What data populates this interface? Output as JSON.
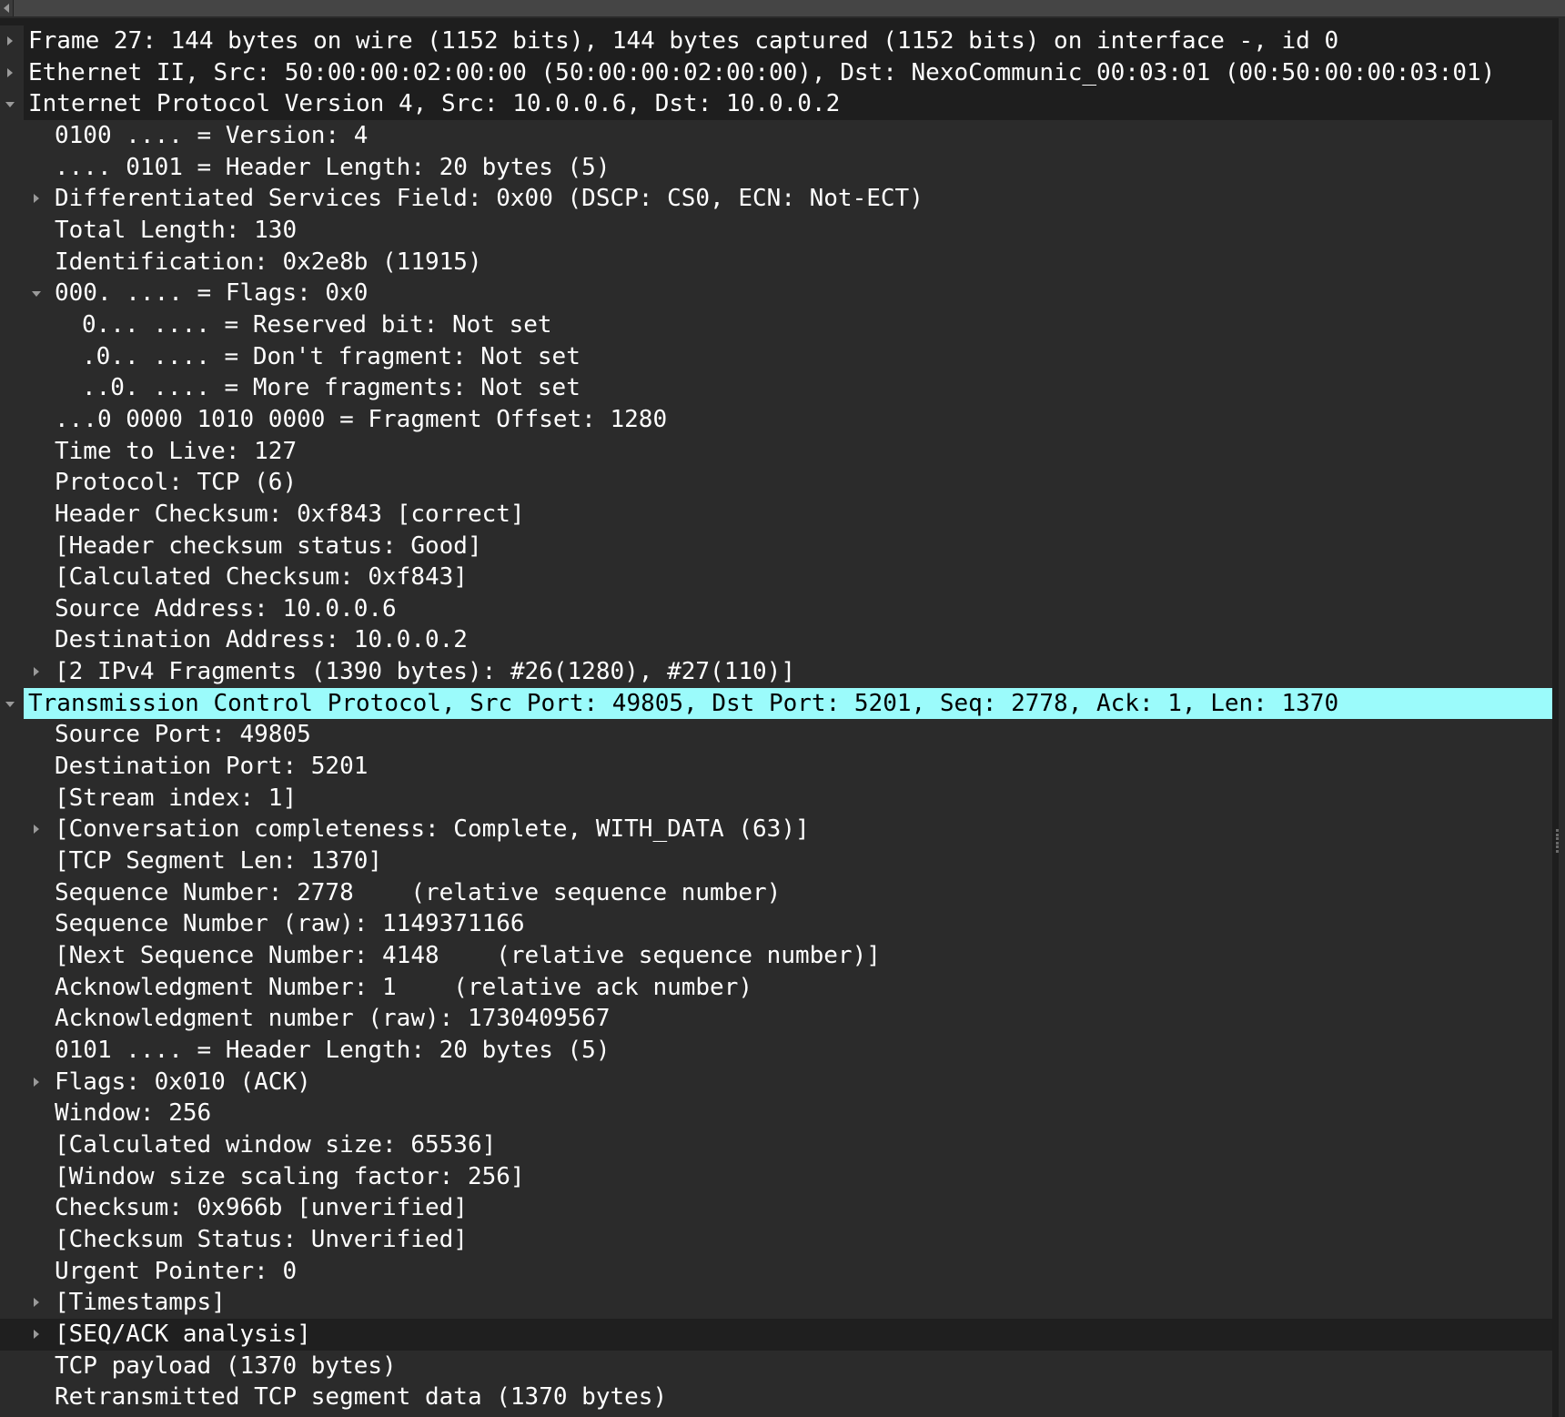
{
  "colors": {
    "background": "#2b2b2b",
    "summary_row": "#1e1e1e",
    "selected_row": "#9bfbfb",
    "text": "#ffffff",
    "selected_text": "#000000"
  },
  "tree": [
    {
      "text": "Frame 27: 144 bytes on wire (1152 bits), 144 bytes captured (1152 bits) on interface -, id 0",
      "level": 0,
      "expander": "collapsed",
      "style": "dark"
    },
    {
      "text": "Ethernet II, Src: 50:00:00:02:00:00 (50:00:00:02:00:00), Dst: NexoCommunic_00:03:01 (00:50:00:00:03:01)",
      "level": 0,
      "expander": "collapsed",
      "style": "dark"
    },
    {
      "text": "Internet Protocol Version 4, Src: 10.0.0.6, Dst: 10.0.0.2",
      "level": 0,
      "expander": "expanded",
      "style": "dark"
    },
    {
      "text": "0100 .... = Version: 4",
      "level": 1
    },
    {
      "text": ".... 0101 = Header Length: 20 bytes (5)",
      "level": 1
    },
    {
      "text": "Differentiated Services Field: 0x00 (DSCP: CS0, ECN: Not-ECT)",
      "level": 1,
      "expander": "collapsed"
    },
    {
      "text": "Total Length: 130",
      "level": 1
    },
    {
      "text": "Identification: 0x2e8b (11915)",
      "level": 1
    },
    {
      "text": "000. .... = Flags: 0x0",
      "level": 1,
      "expander": "expanded"
    },
    {
      "text": "0... .... = Reserved bit: Not set",
      "level": 2
    },
    {
      "text": ".0.. .... = Don't fragment: Not set",
      "level": 2
    },
    {
      "text": "..0. .... = More fragments: Not set",
      "level": 2
    },
    {
      "text": "...0 0000 1010 0000 = Fragment Offset: 1280",
      "level": 1
    },
    {
      "text": "Time to Live: 127",
      "level": 1
    },
    {
      "text": "Protocol: TCP (6)",
      "level": 1
    },
    {
      "text": "Header Checksum: 0xf843 [correct]",
      "level": 1
    },
    {
      "text": "[Header checksum status: Good]",
      "level": 1
    },
    {
      "text": "[Calculated Checksum: 0xf843]",
      "level": 1
    },
    {
      "text": "Source Address: 10.0.0.6",
      "level": 1
    },
    {
      "text": "Destination Address: 10.0.0.2",
      "level": 1
    },
    {
      "text": "[2 IPv4 Fragments (1390 bytes): #26(1280), #27(110)]",
      "level": 1,
      "expander": "collapsed"
    },
    {
      "text": "Transmission Control Protocol, Src Port: 49805, Dst Port: 5201, Seq: 2778, Ack: 1, Len: 1370",
      "level": 0,
      "expander": "expanded",
      "style": "sel"
    },
    {
      "text": "Source Port: 49805",
      "level": 1
    },
    {
      "text": "Destination Port: 5201",
      "level": 1
    },
    {
      "text": "[Stream index: 1]",
      "level": 1
    },
    {
      "text": "[Conversation completeness: Complete, WITH_DATA (63)]",
      "level": 1,
      "expander": "collapsed"
    },
    {
      "text": "[TCP Segment Len: 1370]",
      "level": 1
    },
    {
      "text": "Sequence Number: 2778    (relative sequence number)",
      "level": 1
    },
    {
      "text": "Sequence Number (raw): 1149371166",
      "level": 1
    },
    {
      "text": "[Next Sequence Number: 4148    (relative sequence number)]",
      "level": 1
    },
    {
      "text": "Acknowledgment Number: 1    (relative ack number)",
      "level": 1
    },
    {
      "text": "Acknowledgment number (raw): 1730409567",
      "level": 1
    },
    {
      "text": "0101 .... = Header Length: 20 bytes (5)",
      "level": 1
    },
    {
      "text": "Flags: 0x010 (ACK)",
      "level": 1,
      "expander": "collapsed"
    },
    {
      "text": "Window: 256",
      "level": 1
    },
    {
      "text": "[Calculated window size: 65536]",
      "level": 1
    },
    {
      "text": "[Window size scaling factor: 256]",
      "level": 1
    },
    {
      "text": "Checksum: 0x966b [unverified]",
      "level": 1
    },
    {
      "text": "[Checksum Status: Unverified]",
      "level": 1
    },
    {
      "text": "Urgent Pointer: 0",
      "level": 1
    },
    {
      "text": "[Timestamps]",
      "level": 1,
      "expander": "collapsed"
    },
    {
      "text": "[SEQ/ACK analysis]",
      "level": 1,
      "expander": "collapsed",
      "style": "hover"
    },
    {
      "text": "TCP payload (1370 bytes)",
      "level": 1
    },
    {
      "text": "Retransmitted TCP segment data (1370 bytes)",
      "level": 1
    }
  ]
}
